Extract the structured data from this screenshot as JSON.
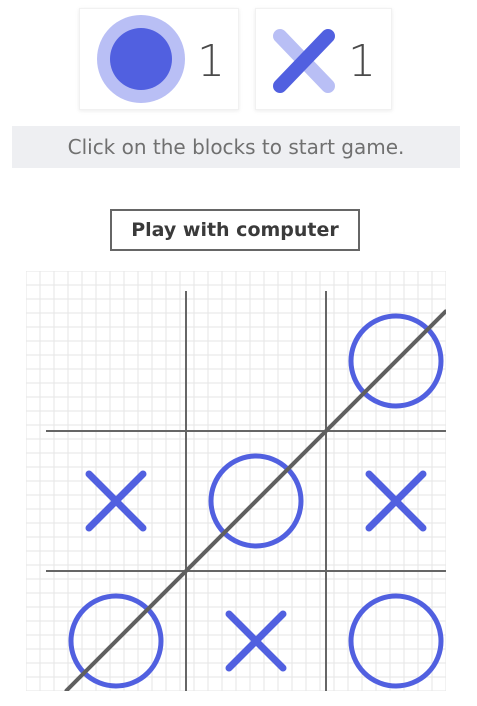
{
  "scoreboard": {
    "o_player": {
      "icon": "circle-icon",
      "score": "1"
    },
    "x_player": {
      "icon": "cross-icon",
      "score": "1"
    }
  },
  "status_message": "Click on the blocks to start game.",
  "play_button_label": "Play with computer",
  "board": {
    "cells": [
      "",
      "",
      "O",
      "X",
      "O",
      "X",
      "O",
      "X",
      "O"
    ],
    "winning_line": [
      6,
      4,
      2
    ]
  },
  "colors": {
    "mark": "#5160e0",
    "mark_light": "#b9bff5",
    "grid_line": "#666666",
    "paper_grid": "#e6e6e6",
    "status_bg": "#eeeff2"
  }
}
